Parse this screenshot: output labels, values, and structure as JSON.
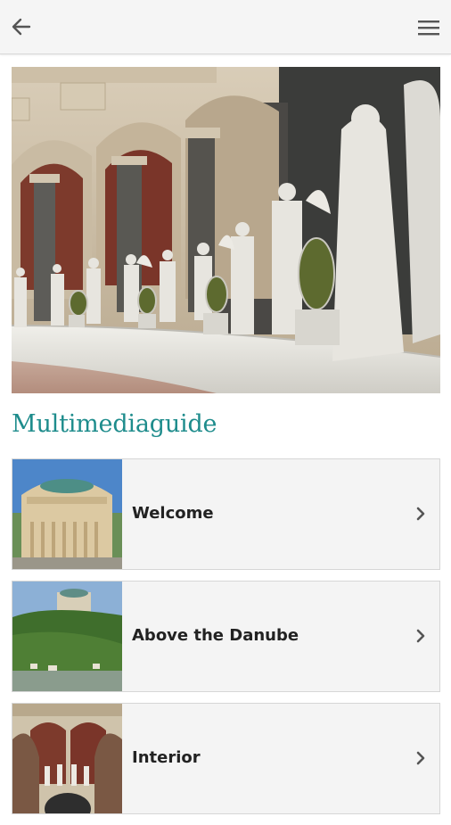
{
  "header": {
    "back_icon": "arrow-left-icon",
    "menu_icon": "hamburger-menu-icon"
  },
  "hero": {
    "description_icon": "hall-of-liberation-statues-photo"
  },
  "section": {
    "title": "Multimediaguide"
  },
  "items": [
    {
      "label": "Welcome",
      "thumbnail": "rotunda-exterior-photo",
      "chevron": "chevron-right-icon"
    },
    {
      "label": "Above the Danube",
      "thumbnail": "danube-hillside-photo",
      "chevron": "chevron-right-icon"
    },
    {
      "label": "Interior",
      "thumbnail": "interior-statues-photo",
      "chevron": "chevron-right-icon"
    }
  ],
  "colors": {
    "accent": "#1e8c8c",
    "header_bg": "#f5f5f5",
    "item_bg": "#f4f4f4",
    "text": "#222222",
    "icon": "#555555"
  }
}
